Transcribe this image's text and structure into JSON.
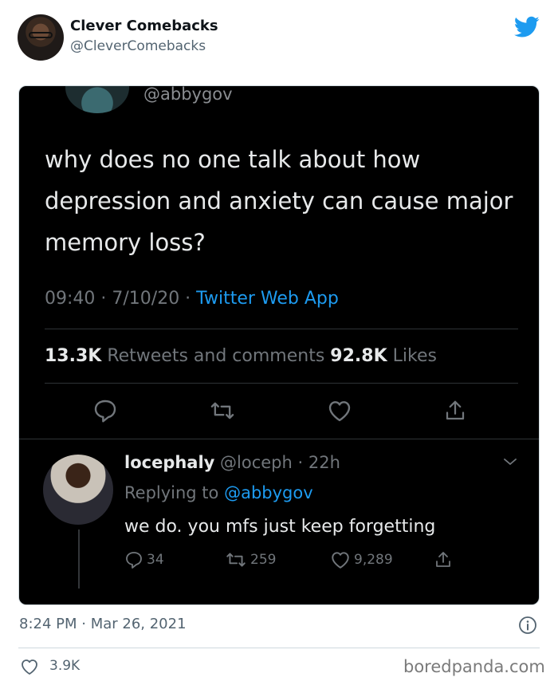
{
  "embed": {
    "author_name": "Clever Comebacks",
    "author_handle": "@CleverComebacks",
    "timestamp": "8:24 PM · Mar 26, 2021",
    "likes": "3.9K",
    "brand_color": "#1d9bf0"
  },
  "screenshot": {
    "handle": "@abbygov",
    "text": "why does no one talk about how depression and anxiety can cause major memory loss?",
    "time": "09:40 · 7/10/20 · ",
    "source": "Twitter Web App",
    "retweets_count": "13.3K",
    "retweets_label": " Retweets and comments ",
    "likes_count": "92.8K",
    "likes_label": " Likes",
    "reply": {
      "name": "locephaly",
      "handle_time": " @loceph · 22h",
      "replying_to_label": "Replying to ",
      "replying_to_handle": "@abbygov",
      "text": "we do. you mfs just keep forgetting",
      "replies": "34",
      "retweets": "259",
      "likes": "9,289"
    }
  },
  "watermark": "boredpanda.com"
}
